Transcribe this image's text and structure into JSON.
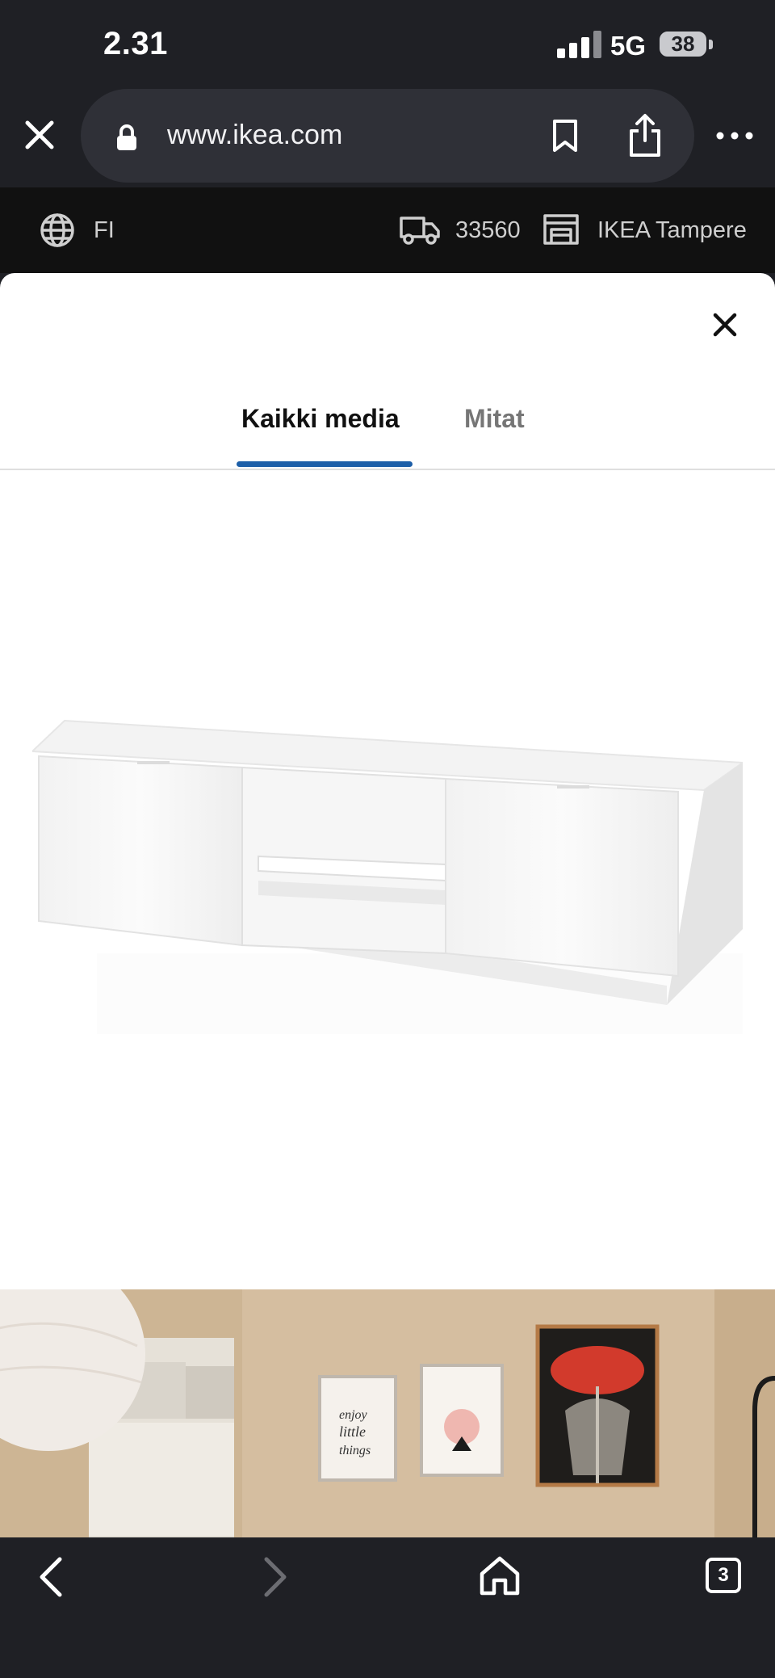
{
  "status_bar": {
    "time": "2.31",
    "network": "5G",
    "battery": "38",
    "signal_bars_active": 3,
    "signal_bars_total": 4
  },
  "browser": {
    "url": "www.ikea.com",
    "icons": {
      "close": "close-icon",
      "lock": "lock-icon",
      "bookmark": "bookmark-icon",
      "share": "share-icon",
      "more": "more-icon"
    }
  },
  "ikea_bar": {
    "language": "FI",
    "postal_code": "33560",
    "store": "IKEA Tampere",
    "icons": {
      "language": "globe-icon",
      "delivery": "truck-icon",
      "store": "store-icon"
    }
  },
  "media_modal": {
    "tabs": [
      {
        "label": "Kaikki media",
        "active": true
      },
      {
        "label": "Mitat",
        "active": false
      }
    ],
    "accent_color": "#1d5fa8"
  },
  "bottom_bar": {
    "tab_count": "3",
    "icons": {
      "back": "chevron-left-icon",
      "forward": "chevron-right-icon",
      "home": "home-icon"
    }
  }
}
